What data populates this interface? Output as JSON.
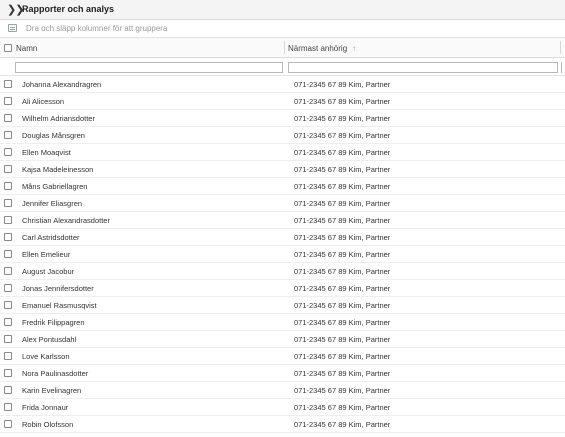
{
  "topbar": {
    "title": "Rapporter och analys",
    "toggle_icon": "double-chevron-right-icon"
  },
  "groupbar": {
    "hint": "Dra och släpp kolumner för att gruppera",
    "icon": "group-icon"
  },
  "columns": {
    "name": "Namn",
    "relative": "Närmast anhörig",
    "sort_arrow": "↑"
  },
  "filters": {
    "name_value": "",
    "relative_value": ""
  },
  "rows": [
    {
      "name": "Johanna Alexandragren",
      "relative": "071-2345 67 89 Kim, Partner"
    },
    {
      "name": "Ali Alicesson",
      "relative": "071-2345 67 89 Kim, Partner"
    },
    {
      "name": "Wilhelm Adriansdotter",
      "relative": "071-2345 67 89 Kim, Partner"
    },
    {
      "name": "Douglas Månsgren",
      "relative": "071-2345 67 89 Kim, Partner"
    },
    {
      "name": "Ellen Moaqvist",
      "relative": "071-2345 67 89 Kim, Partner"
    },
    {
      "name": "Kajsa Madeleinesson",
      "relative": "071-2345 67 89 Kim, Partner"
    },
    {
      "name": "Måns Gabriellagren",
      "relative": "071-2345 67 89 Kim, Partner"
    },
    {
      "name": "Jennifer Eliasgren",
      "relative": "071-2345 67 89 Kim, Partner"
    },
    {
      "name": "Christian Alexandrasdotter",
      "relative": "071-2345 67 89 Kim, Partner"
    },
    {
      "name": "Carl Astridsdotter",
      "relative": "071-2345 67 89 Kim, Partner"
    },
    {
      "name": "Ellen Emelieur",
      "relative": "071-2345 67 89 Kim, Partner"
    },
    {
      "name": "August Jacobur",
      "relative": "071-2345 67 89 Kim, Partner"
    },
    {
      "name": "Jonas Jennifersdotter",
      "relative": "071-2345 67 89 Kim, Partner"
    },
    {
      "name": "Emanuel Rasmusqvist",
      "relative": "071-2345 67 89 Kim, Partner"
    },
    {
      "name": "Fredrik Filippagren",
      "relative": "071-2345 67 89 Kim, Partner"
    },
    {
      "name": "Alex Pontusdahl",
      "relative": "071-2345 67 89 Kim, Partner"
    },
    {
      "name": "Love Karlsson",
      "relative": "071-2345 67 89 Kim, Partner"
    },
    {
      "name": "Nora Paulinasdotter",
      "relative": "071-2345 67 89 Kim, Partner"
    },
    {
      "name": "Karin Evelinagren",
      "relative": "071-2345 67 89 Kim, Partner"
    },
    {
      "name": "Frida Jonnaur",
      "relative": "071-2345 67 89 Kim, Partner"
    },
    {
      "name": "Robin Olofsson",
      "relative": "071-2345 67 89 Kim, Partner"
    }
  ]
}
